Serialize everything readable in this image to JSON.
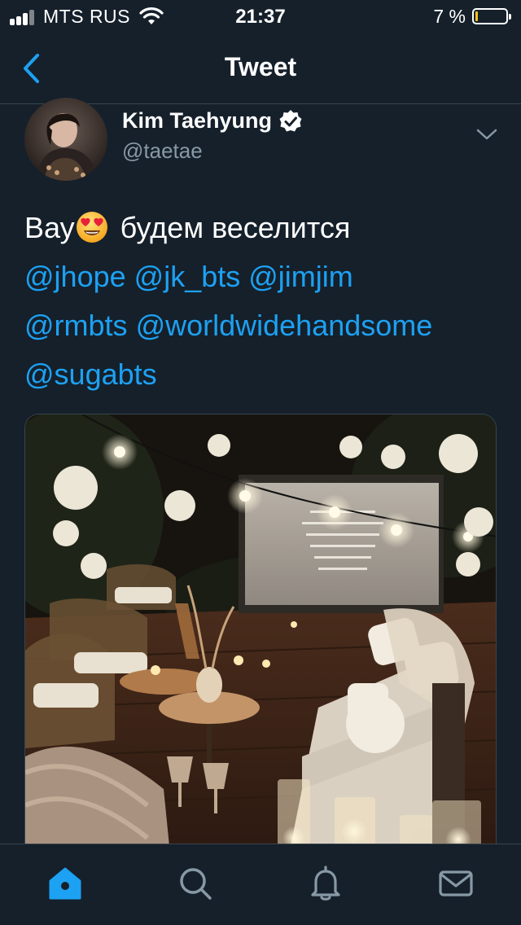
{
  "status_bar": {
    "carrier": "MTS RUS",
    "time": "21:37",
    "battery_percent": "7 %",
    "battery_level": 0.07,
    "battery_color": "#f5c518"
  },
  "navbar": {
    "title": "Tweet",
    "back_icon": "chevron-left-icon"
  },
  "tweet": {
    "author": {
      "display_name": "Kim Taehyung",
      "handle": "@taetae",
      "verified": true
    },
    "text_prefix": "Вау",
    "emoji": "heart-eyes-emoji",
    "text_main": "будем веселится",
    "mentions": [
      "@jhope",
      "@jk_bts",
      "@jimjim",
      "@rmbts",
      "@worldwidehandsome",
      "@sugabts"
    ],
    "media_description_icon": "photo-outdoor-cinema"
  },
  "tabbar": {
    "tabs": [
      {
        "name": "home",
        "icon": "home-icon",
        "active": true
      },
      {
        "name": "search",
        "icon": "search-icon",
        "active": false
      },
      {
        "name": "notifications",
        "icon": "bell-icon",
        "active": false
      },
      {
        "name": "messages",
        "icon": "mail-icon",
        "active": false
      }
    ]
  },
  "colors": {
    "background": "#15202b",
    "accent": "#1da1f2",
    "secondary_text": "#8899a6",
    "divider": "#38444d"
  }
}
